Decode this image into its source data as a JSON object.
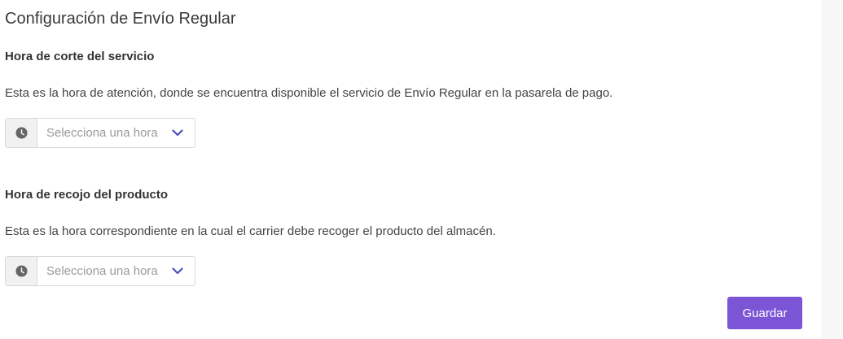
{
  "page": {
    "title": "Configuración de Envío Regular"
  },
  "sections": [
    {
      "title": "Hora de corte del servicio",
      "description": "Esta es la hora de atención, donde se encuentra disponible el servicio de Envío Regular en la pasarela de pago.",
      "select": {
        "placeholder": "Selecciona una hora",
        "icon": "clock-icon"
      }
    },
    {
      "title": "Hora de recojo del producto",
      "description": "Esta es la hora correspondiente en la cual el carrier debe recoger el producto del almacén.",
      "select": {
        "placeholder": "Selecciona una hora",
        "icon": "clock-icon"
      }
    }
  ],
  "actions": {
    "save_label": "Guardar"
  },
  "colors": {
    "accent": "#7b55d6",
    "chevron": "#4b4fbf",
    "icon_gray": "#666666"
  }
}
